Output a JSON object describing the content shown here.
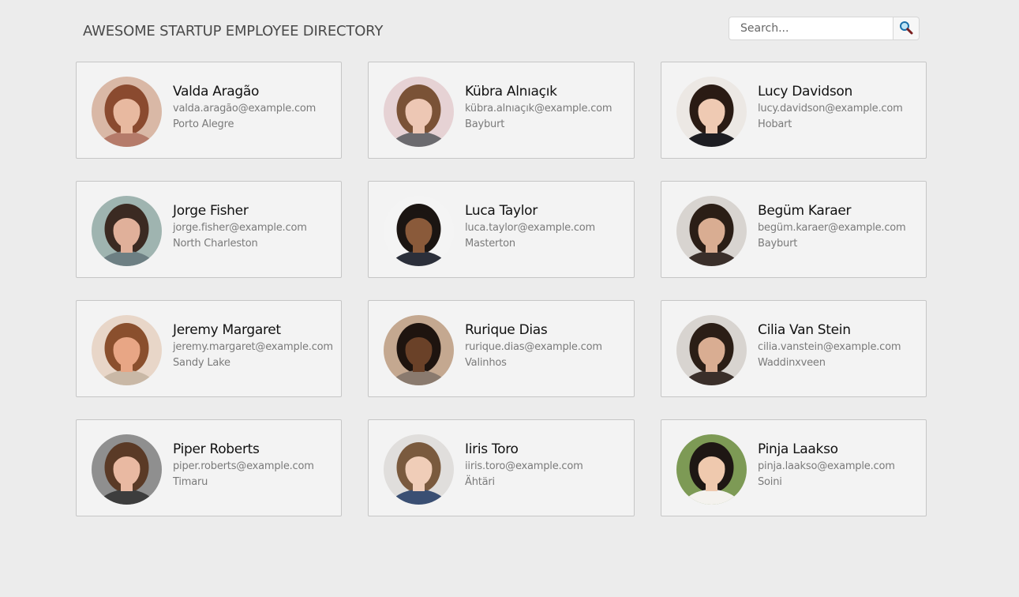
{
  "header": {
    "title": "AWESOME STARTUP EMPLOYEE DIRECTORY",
    "search_placeholder": "Search...",
    "search_value": "",
    "search_icon": "magnifier-icon"
  },
  "employees": [
    {
      "name": "Valda Aragão",
      "email": "valda.aragão@example.com",
      "location": "Porto Alegre",
      "bg": "#d9b8a6",
      "hair": "#8a4a2f",
      "skin": "#e8b9a0",
      "top": "#b57b6a"
    },
    {
      "name": "Kübra Alnıaçık",
      "email": "kübra.alnıaçık@example.com",
      "location": "Bayburt",
      "bg": "#e6d2d4",
      "hair": "#7a5236",
      "skin": "#edc7b4",
      "top": "#6b6a6e"
    },
    {
      "name": "Lucy Davidson",
      "email": "lucy.davidson@example.com",
      "location": "Hobart",
      "bg": "#ece8e4",
      "hair": "#2a1b14",
      "skin": "#efcab3",
      "top": "#1d1d22"
    },
    {
      "name": "Jorge Fisher",
      "email": "jorge.fisher@example.com",
      "location": "North Charleston",
      "bg": "#9fb4b0",
      "hair": "#3b2a22",
      "skin": "#e0b09a",
      "top": "#6d7f83"
    },
    {
      "name": "Luca Taylor",
      "email": "luca.taylor@example.com",
      "location": "Masterton",
      "bg": "#f4f4f4",
      "hair": "#1b1512",
      "skin": "#8a5a3a",
      "top": "#2b2f3a"
    },
    {
      "name": "Begüm Karaer",
      "email": "begüm.karaer@example.com",
      "location": "Bayburt",
      "bg": "#d8d4d0",
      "hair": "#2b1e16",
      "skin": "#d9ad92",
      "top": "#3a2f2a"
    },
    {
      "name": "Jeremy Margaret",
      "email": "jeremy.margaret@example.com",
      "location": "Sandy Lake",
      "bg": "#e8d6c8",
      "hair": "#8a4f2d",
      "skin": "#e8a685",
      "top": "#c9b8a6"
    },
    {
      "name": "Rurique Dias",
      "email": "rurique.dias@example.com",
      "location": "Valinhos",
      "bg": "#c4a890",
      "hair": "#1e140f",
      "skin": "#6a4128",
      "top": "#8a7a6e"
    },
    {
      "name": "Cilia Van Stein",
      "email": "cilia.vanstein@example.com",
      "location": "Waddinxveen",
      "bg": "#d8d4d0",
      "hair": "#2b1e16",
      "skin": "#d9ad92",
      "top": "#3a2f2a"
    },
    {
      "name": "Piper Roberts",
      "email": "piper.roberts@example.com",
      "location": "Timaru",
      "bg": "#8f8f8f",
      "hair": "#5a3a26",
      "skin": "#e9b9a2",
      "top": "#3d3d3d"
    },
    {
      "name": "Iiris Toro",
      "email": "iiris.toro@example.com",
      "location": "Ähtäri",
      "bg": "#e0dedc",
      "hair": "#7a5a3e",
      "skin": "#f0cdb8",
      "top": "#3a4f73"
    },
    {
      "name": "Pinja Laakso",
      "email": "pinja.laakso@example.com",
      "location": "Soini",
      "bg": "#7d9a55",
      "hair": "#1e1714",
      "skin": "#efc9ae",
      "top": "#f4f2ee"
    }
  ]
}
